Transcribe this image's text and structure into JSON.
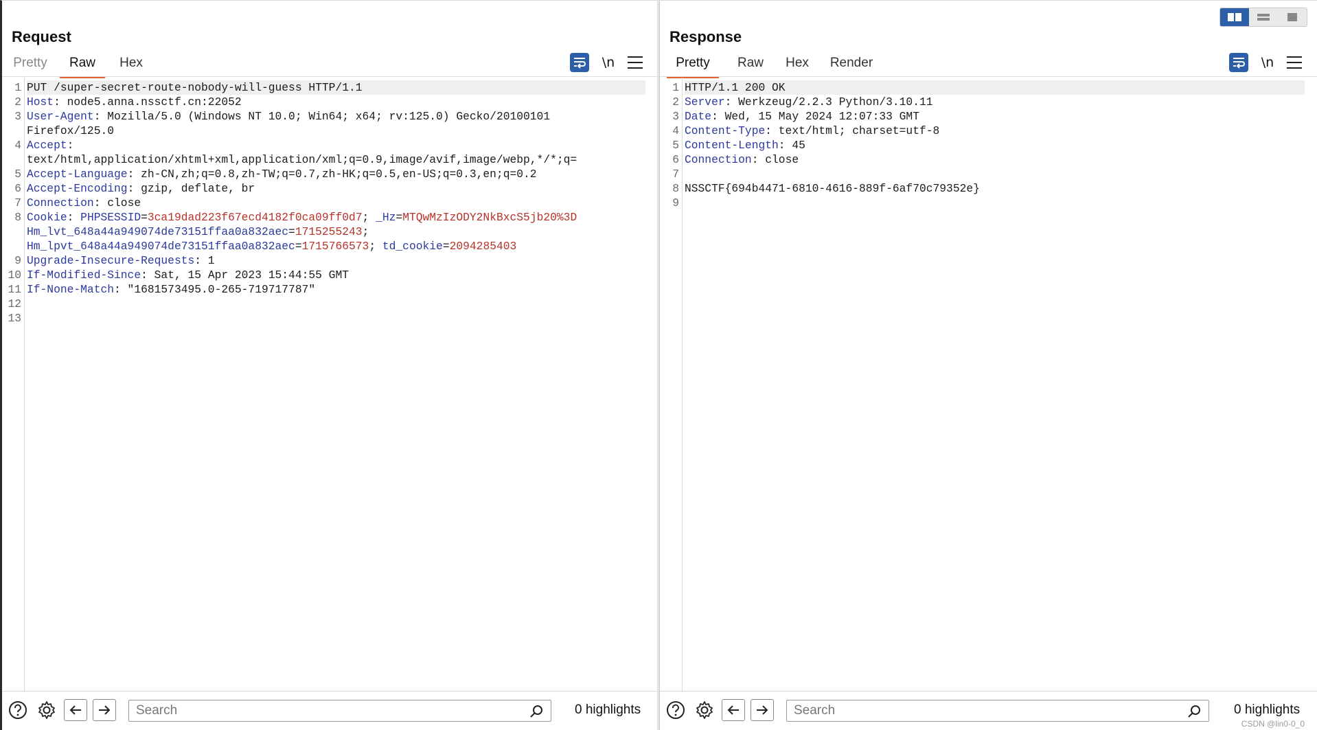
{
  "request": {
    "title": "Request",
    "tabs": [
      "Pretty",
      "Raw",
      "Hex"
    ],
    "active_tab": "Raw",
    "lines": [
      {
        "n": "1",
        "parts": [
          {
            "t": "PUT /super-secret-route-nobody-will-guess HTTP/1.1",
            "c": "v"
          }
        ],
        "hl": true
      },
      {
        "n": "2",
        "parts": [
          {
            "t": "Host",
            "c": "k"
          },
          {
            "t": ": node5.anna.nssctf.cn:22052",
            "c": "v"
          }
        ]
      },
      {
        "n": "3",
        "parts": [
          {
            "t": "User-Agent",
            "c": "k"
          },
          {
            "t": ": Mozilla/5.0 (Windows NT 10.0; Win64; x64; rv:125.0) Gecko/20100101",
            "c": "v"
          }
        ]
      },
      {
        "n": "",
        "parts": [
          {
            "t": "Firefox/125.0",
            "c": "v"
          }
        ]
      },
      {
        "n": "4",
        "parts": [
          {
            "t": "Accept",
            "c": "k"
          },
          {
            "t": ":",
            "c": "v"
          }
        ]
      },
      {
        "n": "",
        "parts": [
          {
            "t": "text/html,application/xhtml+xml,application/xml;q=0.9,image/avif,image/webp,*/*;q=",
            "c": "v"
          }
        ]
      },
      {
        "n": "5",
        "parts": [
          {
            "t": "Accept-Language",
            "c": "k"
          },
          {
            "t": ": zh-CN,zh;q=0.8,zh-TW;q=0.7,zh-HK;q=0.5,en-US;q=0.3,en;q=0.2",
            "c": "v"
          }
        ]
      },
      {
        "n": "6",
        "parts": [
          {
            "t": "Accept-Encoding",
            "c": "k"
          },
          {
            "t": ": gzip, deflate, br",
            "c": "v"
          }
        ]
      },
      {
        "n": "7",
        "parts": [
          {
            "t": "Connection",
            "c": "k"
          },
          {
            "t": ": close",
            "c": "v"
          }
        ]
      },
      {
        "n": "8",
        "parts": [
          {
            "t": "Cookie",
            "c": "k"
          },
          {
            "t": ": ",
            "c": "v"
          },
          {
            "t": "PHPSESSID",
            "c": "k"
          },
          {
            "t": "=",
            "c": "v"
          },
          {
            "t": "3ca19dad223f67ecd4182f0ca09ff0d7",
            "c": "c"
          },
          {
            "t": "; ",
            "c": "v"
          },
          {
            "t": "_Hz",
            "c": "k"
          },
          {
            "t": "=",
            "c": "v"
          },
          {
            "t": "MTQwMzIzODY2NkBxcS5jb20%3D",
            "c": "c"
          }
        ]
      },
      {
        "n": "",
        "parts": [
          {
            "t": "Hm_lvt_648a44a949074de73151ffaa0a832aec",
            "c": "k"
          },
          {
            "t": "=",
            "c": "v"
          },
          {
            "t": "1715255243",
            "c": "c"
          },
          {
            "t": ";",
            "c": "v"
          }
        ]
      },
      {
        "n": "",
        "parts": [
          {
            "t": "Hm_lpvt_648a44a949074de73151ffaa0a832aec",
            "c": "k"
          },
          {
            "t": "=",
            "c": "v"
          },
          {
            "t": "1715766573",
            "c": "c"
          },
          {
            "t": "; ",
            "c": "v"
          },
          {
            "t": "td_cookie",
            "c": "k"
          },
          {
            "t": "=",
            "c": "v"
          },
          {
            "t": "2094285403",
            "c": "c"
          }
        ]
      },
      {
        "n": "9",
        "parts": [
          {
            "t": "Upgrade-Insecure-Requests",
            "c": "k"
          },
          {
            "t": ": 1",
            "c": "v"
          }
        ]
      },
      {
        "n": "10",
        "parts": [
          {
            "t": "If-Modified-Since",
            "c": "k"
          },
          {
            "t": ": Sat, 15 Apr 2023 15:44:55 GMT",
            "c": "v"
          }
        ]
      },
      {
        "n": "11",
        "parts": [
          {
            "t": "If-None-Match",
            "c": "k"
          },
          {
            "t": ": \"1681573495.0-265-719717787\"",
            "c": "v"
          }
        ]
      },
      {
        "n": "12",
        "parts": [
          {
            "t": "",
            "c": "v"
          }
        ]
      },
      {
        "n": "13",
        "parts": [
          {
            "t": "",
            "c": "v"
          }
        ]
      }
    ],
    "search_placeholder": "Search",
    "highlights": "0 highlights"
  },
  "response": {
    "title": "Response",
    "tabs": [
      "Pretty",
      "Raw",
      "Hex",
      "Render"
    ],
    "active_tab": "Pretty",
    "lines": [
      {
        "n": "1",
        "parts": [
          {
            "t": "HTTP/1.1 200 OK",
            "c": "v"
          }
        ],
        "hl": true
      },
      {
        "n": "2",
        "parts": [
          {
            "t": "Server",
            "c": "k"
          },
          {
            "t": ": Werkzeug/2.2.3 Python/3.10.11",
            "c": "v"
          }
        ]
      },
      {
        "n": "3",
        "parts": [
          {
            "t": "Date",
            "c": "k"
          },
          {
            "t": ": Wed, 15 May 2024 12:07:33 GMT",
            "c": "v"
          }
        ]
      },
      {
        "n": "4",
        "parts": [
          {
            "t": "Content-Type",
            "c": "k"
          },
          {
            "t": ": text/html; charset=utf-8",
            "c": "v"
          }
        ]
      },
      {
        "n": "5",
        "parts": [
          {
            "t": "Content-Length",
            "c": "k"
          },
          {
            "t": ": 45",
            "c": "v"
          }
        ]
      },
      {
        "n": "6",
        "parts": [
          {
            "t": "Connection",
            "c": "k"
          },
          {
            "t": ": close",
            "c": "v"
          }
        ]
      },
      {
        "n": "7",
        "parts": [
          {
            "t": "",
            "c": "v"
          }
        ]
      },
      {
        "n": "8",
        "parts": [
          {
            "t": "NSSCTF{694b4471-6810-4616-889f-6af70c79352e}",
            "c": "v"
          }
        ]
      },
      {
        "n": "9",
        "parts": [
          {
            "t": "",
            "c": "v"
          }
        ]
      }
    ],
    "search_placeholder": "Search",
    "highlights": "0 highlights"
  },
  "watermark": "CSDN @lin0-0_0",
  "colors": {
    "accent": "#2d5fa8",
    "tab_underline": "#e8602c",
    "header_key": "#2c3a9e",
    "cookie_value": "#b5332a"
  },
  "icons": {
    "help": "help-icon",
    "settings": "gear-icon",
    "back": "arrow-left-icon",
    "forward": "arrow-right-icon",
    "search": "search-icon",
    "wrap": "word-wrap-icon",
    "newline": "newline-icon",
    "menu": "hamburger-menu-icon"
  }
}
